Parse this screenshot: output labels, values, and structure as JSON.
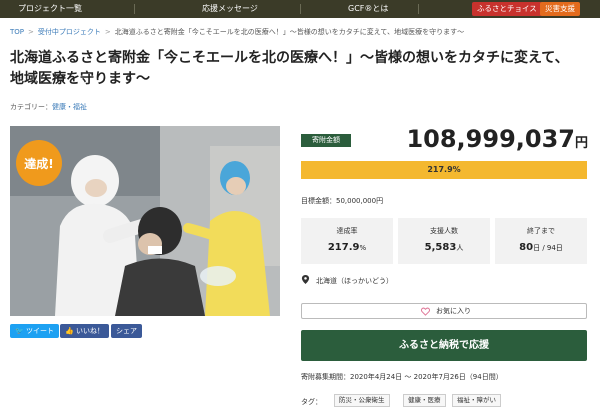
{
  "header": {
    "nav": [
      "プロジェクト一覧",
      "応援メッセージ",
      "GCF®とは"
    ],
    "furusato_choice": "ふるさとチョイス",
    "disaster_support": "災害支援",
    "colors": {
      "bar": "#3b3b28",
      "furusato_choice": "#c8322d",
      "disaster_support": "#e36b1d"
    }
  },
  "breadcrumb": [
    "TOP",
    "受付中プロジェクト",
    "北海道ふるさと寄附金「今こそエールを北の医療へ！」〜皆様の想いをカタチに変えて、地域医療を守ります〜"
  ],
  "project": {
    "title": "北海道ふるさと寄附金「今こそエールを北の医療へ！」〜皆様の想いをカタチに変えて、地域医療を守ります〜",
    "category_label": "カテゴリー：",
    "category": "健康・福祉",
    "achieved_badge": "達成!"
  },
  "share": {
    "tweet": "ツイート",
    "like": "いいね！",
    "share": "シェア"
  },
  "donation": {
    "label": "寄附金額",
    "amount": "108,999,037",
    "unit": "円",
    "progress_text": "217.9%",
    "progress_fraction": 1.0,
    "target": "目標金額：50,000,000円"
  },
  "stats": [
    {
      "label": "達成率",
      "value": "217.9",
      "suffix": "%"
    },
    {
      "label": "支援人数",
      "value": "5,583",
      "suffix": "人"
    },
    {
      "label": "終了まで",
      "value": "80",
      "suffix": "日 / 94日"
    }
  ],
  "location": "北海道（ほっかいどう）",
  "favorite": "お気に入り",
  "donate_button": "ふるさと納税で応援",
  "period": "寄附募集期間：2020年4月24日 〜 2020年7月26日（94日間）",
  "tags": {
    "label": "タグ：",
    "items": [
      "防災・公衆衛生",
      "健康・医療",
      "福祉・障がい"
    ]
  },
  "colors": {
    "accent_green": "#2b5d3c",
    "progress": "#f4b82f",
    "badge": "#f09a1c",
    "twitter": "#1da1f2",
    "facebook": "#3b5998"
  }
}
